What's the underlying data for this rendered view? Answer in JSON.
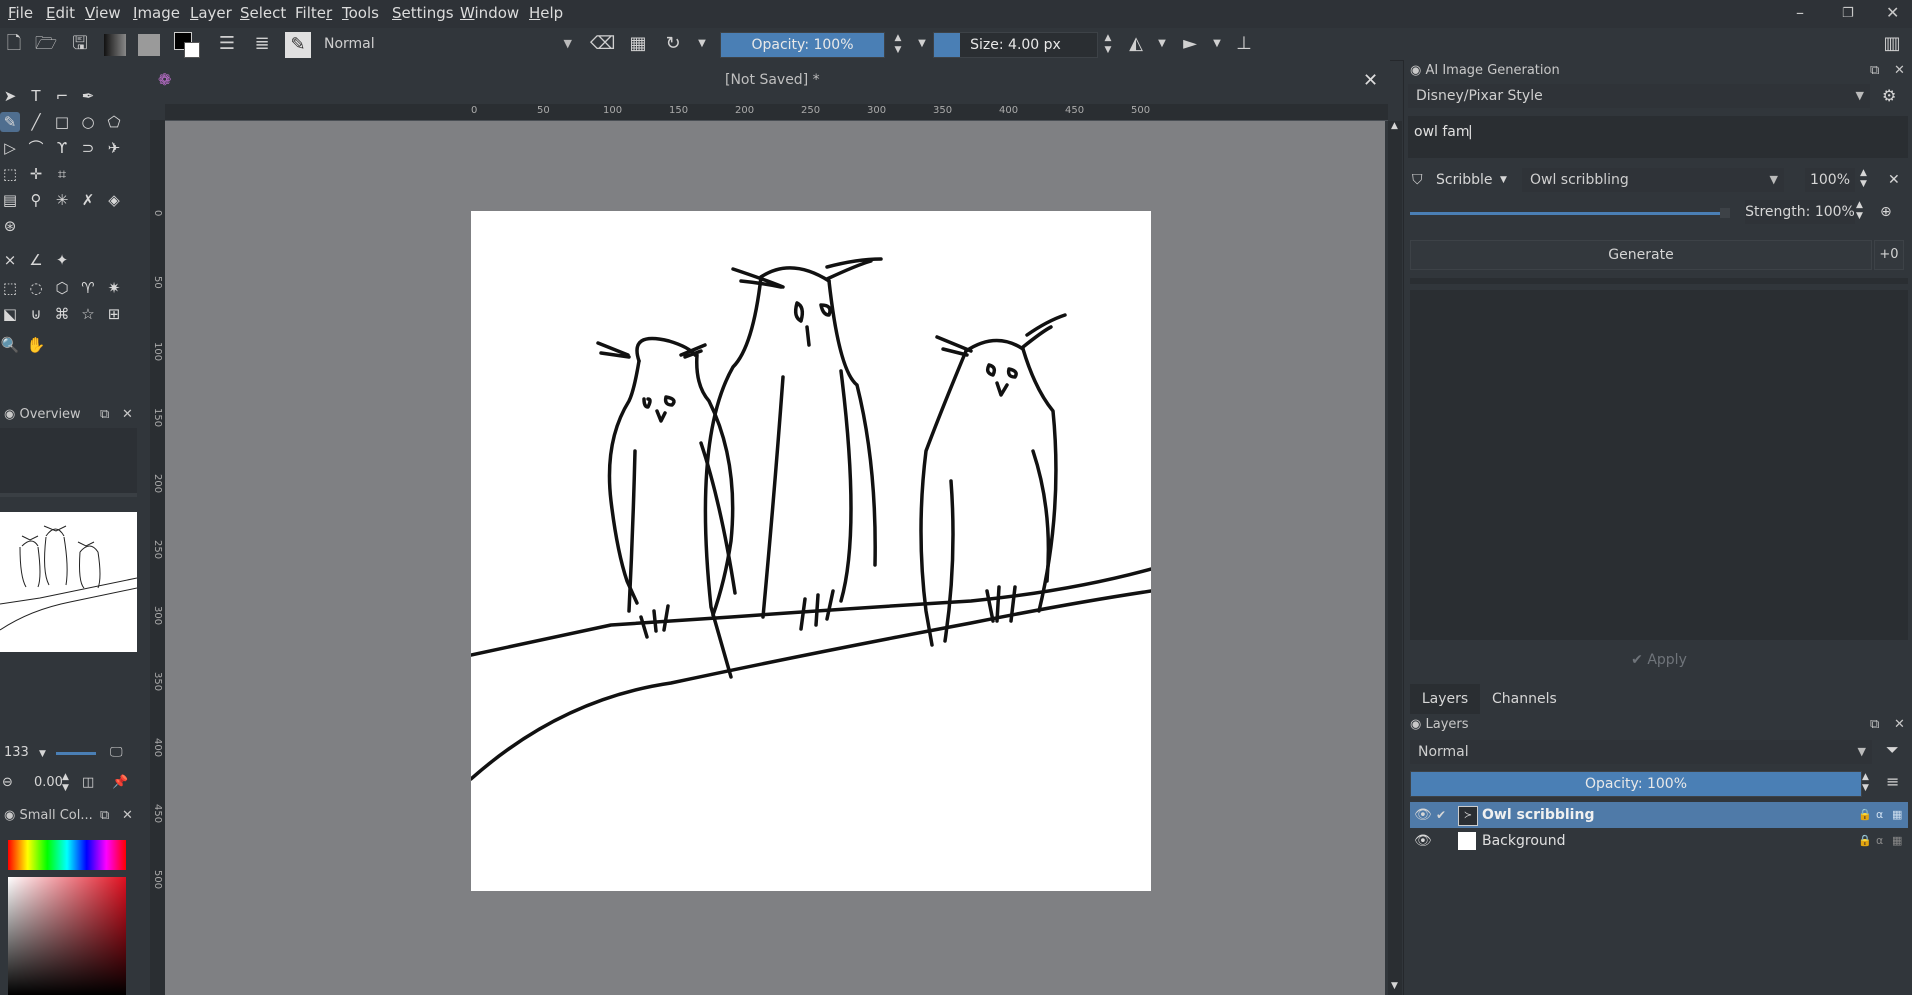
{
  "menu": [
    "File",
    "Edit",
    "View",
    "Image",
    "Layer",
    "Select",
    "Filter",
    "Tools",
    "Settings",
    "Window",
    "Help"
  ],
  "menu_underline": [
    "F",
    "E",
    "V",
    "I",
    "L",
    "S",
    "F",
    "T",
    "S",
    "W",
    "H"
  ],
  "menu_rest": [
    "ile",
    "dit",
    "iew",
    "mage",
    "ayer",
    "elect",
    "ilter",
    "ools",
    "ettings",
    "indow",
    "elp"
  ],
  "menu_prefix": [
    "",
    "",
    "",
    "",
    "",
    "",
    "Filte",
    "",
    "",
    "",
    ""
  ],
  "toolbar": {
    "blend_mode": "Normal",
    "opacity": "Opacity: 100%",
    "size": "Size: 4.00 px"
  },
  "document": {
    "title": "[Not Saved]  *"
  },
  "ruler": {
    "h_ticks": [
      "0",
      "50",
      "100",
      "150",
      "200",
      "250",
      "300",
      "350",
      "400",
      "450",
      "500"
    ],
    "v_ticks": [
      "0",
      "50",
      "100",
      "150",
      "200",
      "250",
      "300",
      "350",
      "400",
      "450",
      "500"
    ]
  },
  "overview": {
    "title": "Overview",
    "zoom": "133",
    "rotation": "0.00"
  },
  "small_color": {
    "title": "Small Col..."
  },
  "ai": {
    "title": "AI Image Generation",
    "style": "Disney/Pixar Style",
    "prompt": "owl fam",
    "control_type": "Scribble",
    "control_layer": "Owl scribbling",
    "control_percent": "100%",
    "strength": "Strength: 100%",
    "generate_label": "Generate",
    "plus_badge": "+0",
    "apply_label": "Apply"
  },
  "layers": {
    "tabs": [
      "Layers",
      "Channels"
    ],
    "title": "Layers",
    "blend_mode": "Normal",
    "opacity": "Opacity:  100%",
    "items": [
      {
        "name": "Owl scribbling",
        "selected": true
      },
      {
        "name": "Background",
        "selected": false
      }
    ]
  },
  "colors": {
    "accent": "#4a7fb5",
    "selection": "#4f7aa8",
    "canvas_bg": "#7f8083"
  }
}
